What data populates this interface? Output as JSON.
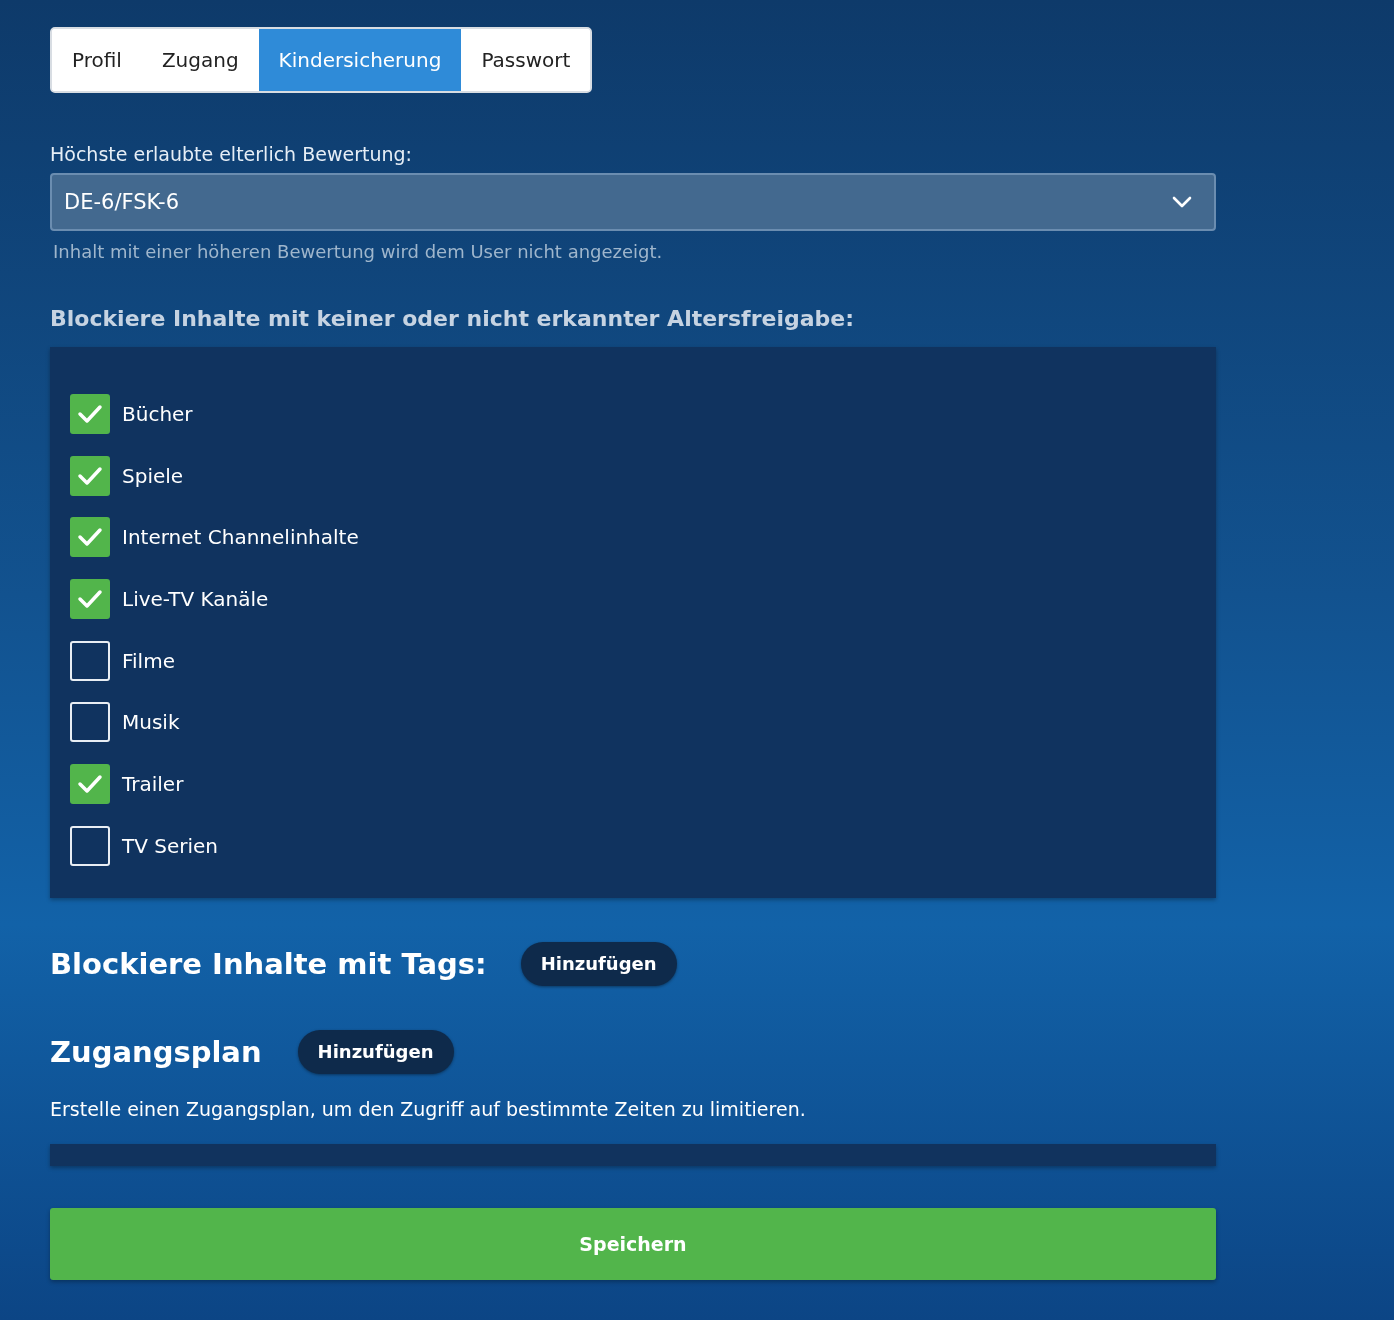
{
  "tabs": [
    {
      "label": "Profil",
      "selected": false
    },
    {
      "label": "Zugang",
      "selected": false
    },
    {
      "label": "Kindersicherung",
      "selected": true
    },
    {
      "label": "Passwort",
      "selected": false
    }
  ],
  "rating": {
    "label": "Höchste erlaubte elterlich Bewertung:",
    "value": "DE-6/FSK-6",
    "hint": "Inhalt mit einer höheren Bewertung wird dem User nicht angezeigt."
  },
  "unrated": {
    "heading": "Blockiere Inhalte mit keiner oder nicht erkannter Altersfreigabe:",
    "items": [
      {
        "label": "Bücher",
        "checked": true
      },
      {
        "label": "Spiele",
        "checked": true
      },
      {
        "label": "Internet Channelinhalte",
        "checked": true
      },
      {
        "label": "Live-TV Kanäle",
        "checked": true
      },
      {
        "label": "Filme",
        "checked": false
      },
      {
        "label": "Musik",
        "checked": false
      },
      {
        "label": "Trailer",
        "checked": true
      },
      {
        "label": "TV Serien",
        "checked": false
      }
    ]
  },
  "tags": {
    "heading": "Blockiere Inhalte mit Tags:",
    "button": "Hinzufügen"
  },
  "schedule": {
    "heading": "Zugangsplan",
    "button": "Hinzufügen",
    "description": "Erstelle einen Zugangsplan, um den Zugriff auf bestimmte Zeiten zu limitieren."
  },
  "save_button": "Speichern"
}
